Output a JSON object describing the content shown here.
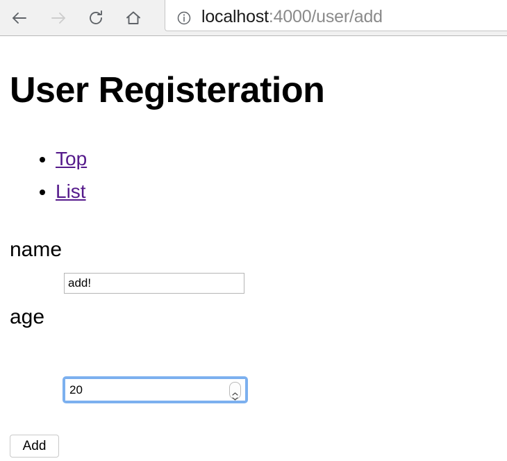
{
  "browser": {
    "back_icon": "arrow-left-icon",
    "forward_icon": "arrow-right-icon",
    "reload_icon": "reload-icon",
    "home_icon": "home-icon",
    "page_info_icon": "info-circle-icon",
    "url_host": "localhost",
    "url_path": ":4000/user/add",
    "url_full": "localhost:4000/user/add",
    "toolbar_bg": "#f1f1f1",
    "icon_color_enabled": "#5f6368",
    "icon_color_disabled": "#c8c8c8"
  },
  "page": {
    "title": "User Registeration",
    "nav_links": [
      {
        "label": "Top"
      },
      {
        "label": "List"
      }
    ],
    "link_color": "#551a8b",
    "fields": {
      "name": {
        "label": "name",
        "value": "add!",
        "placeholder": ""
      },
      "age": {
        "label": "age",
        "value": "20",
        "placeholder": "",
        "focus_ring_color": "#7cb0ef",
        "spinner_up_icon": "chevron-up-icon",
        "spinner_down_icon": "chevron-down-icon"
      }
    },
    "submit_label": "Add"
  }
}
